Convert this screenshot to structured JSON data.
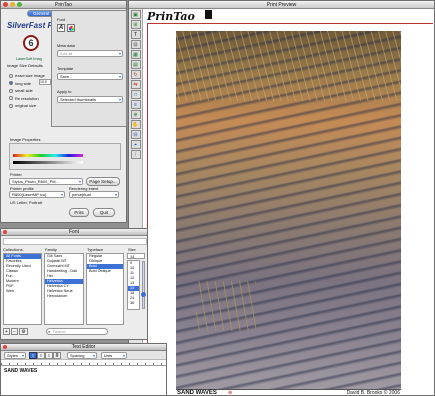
{
  "print_preview": {
    "window_title": "Print Preview",
    "logo_text": "PrinTao",
    "caption_left": "SAND WAVES",
    "caption_right": "David B. Brooks © 2006"
  },
  "printao_panel": {
    "window_title": "PrinTao",
    "brand": "SilverFast Pri",
    "brand_sub": "LaserSoft Imag",
    "image_size_defaults": "Image Size Defaults",
    "radio_options": [
      "exact size image",
      "long side",
      "small side",
      "Re resolution",
      "original size"
    ],
    "long_side_value": "10.0",
    "image_properties": "Image Properties",
    "printer_label": "Printer",
    "printer_value": "Stylus_Photo_R800_PM...",
    "page_setup": "Page Setup...",
    "printer_profile_label": "Printer profile",
    "printer_profile_value": "R800(LaserMP ico)",
    "rendering_intent_label": "Rendering intent",
    "rendering_intent_value": "perceptual",
    "paper_info": "US Letter, Portrait",
    "print_button": "Print",
    "quit_button": "Quit"
  },
  "tab_general": "General",
  "drawer": {
    "font_label": "Font",
    "meta_data_label": "Meta data",
    "add_all": "Add all",
    "template_label": "Template",
    "template_value": "Save...",
    "apply_to_label": "Apply to",
    "apply_to_value": "Selected thumbnails"
  },
  "font_panel": {
    "window_title": "Font",
    "headers": [
      "Collections",
      "Family",
      "Typeface",
      "Size"
    ],
    "collections": [
      "All Fonts",
      "Favorites",
      "Recently Used",
      "Classic",
      "Fun",
      "Modern",
      "PDF",
      "Web"
    ],
    "families": [
      "Gill Sans",
      "Gujarati MT",
      "Gurmukhi MT",
      "Handwriting - Dak",
      "Hei",
      "Helvetica",
      "Helvetica CY",
      "Helvetica Neue",
      "Herculanum"
    ],
    "typefaces": [
      "Regular",
      "Oblique",
      "Bold",
      "Bold Oblique"
    ],
    "sizes": [
      "9",
      "10",
      "11",
      "12",
      "13",
      "14",
      "18",
      "24",
      "36"
    ],
    "size_value": "14",
    "search_placeholder": "Search"
  },
  "text_editor": {
    "window_title": "Text Editor",
    "styles_label": "Styles",
    "spacing_label": "Spacing",
    "lists_label": "Lists",
    "content": "SAND WAVES"
  }
}
